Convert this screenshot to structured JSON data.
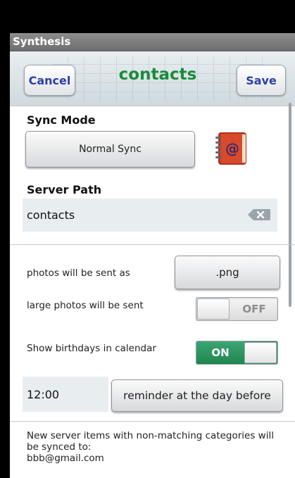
{
  "app": {
    "title": "Synthesis"
  },
  "header": {
    "cancel_label": "Cancel",
    "title": "contacts",
    "save_label": "Save"
  },
  "sync_mode": {
    "label": "Sync Mode",
    "value": "Normal Sync"
  },
  "server_path": {
    "label": "Server Path",
    "value": "contacts"
  },
  "photos": {
    "format_label": "photos will be sent as",
    "format_value": ".png",
    "large_label": "large photos will be sent",
    "large_toggle": "OFF"
  },
  "birthdays": {
    "label": "Show birthdays in calendar",
    "toggle": "ON",
    "time": "12:00",
    "reminder": "reminder at the day before"
  },
  "footer": {
    "line1": "New server items with non-matching categories will be synced to:",
    "line2": "bbb@gmail.com"
  },
  "colors": {
    "title_green": "#1d8a3c",
    "button_blue": "#2c3fa8",
    "toggle_on_green": "#2e9a67"
  }
}
